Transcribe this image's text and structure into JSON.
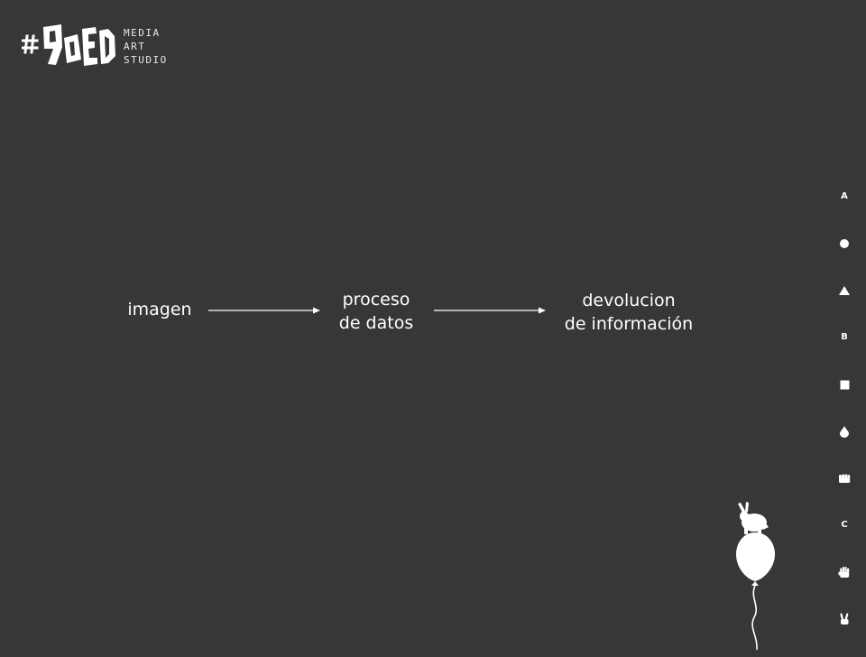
{
  "logo": {
    "mark_text": "#9OED",
    "lines": [
      "MEDIA",
      "ART",
      "STUDIO"
    ]
  },
  "flow": {
    "step1": "imagen",
    "step2": [
      "proceso",
      "de datos"
    ],
    "step3": [
      "devolucion",
      "de información"
    ]
  },
  "side_nav": {
    "items": [
      {
        "label": "A",
        "icon": "letter-a-icon"
      },
      {
        "icon": "circle-icon"
      },
      {
        "icon": "triangle-icon"
      },
      {
        "label": "B",
        "icon": "letter-b-icon"
      },
      {
        "icon": "square-icon"
      },
      {
        "icon": "drop-icon"
      },
      {
        "icon": "fist-icon"
      },
      {
        "label": "C",
        "icon": "letter-c-icon"
      },
      {
        "icon": "open-hand-icon"
      },
      {
        "icon": "peace-hand-icon"
      }
    ]
  },
  "decoration": {
    "icon": "rabbit-balloon-icon"
  },
  "colors": {
    "background": "#373737",
    "foreground": "#ffffff"
  }
}
